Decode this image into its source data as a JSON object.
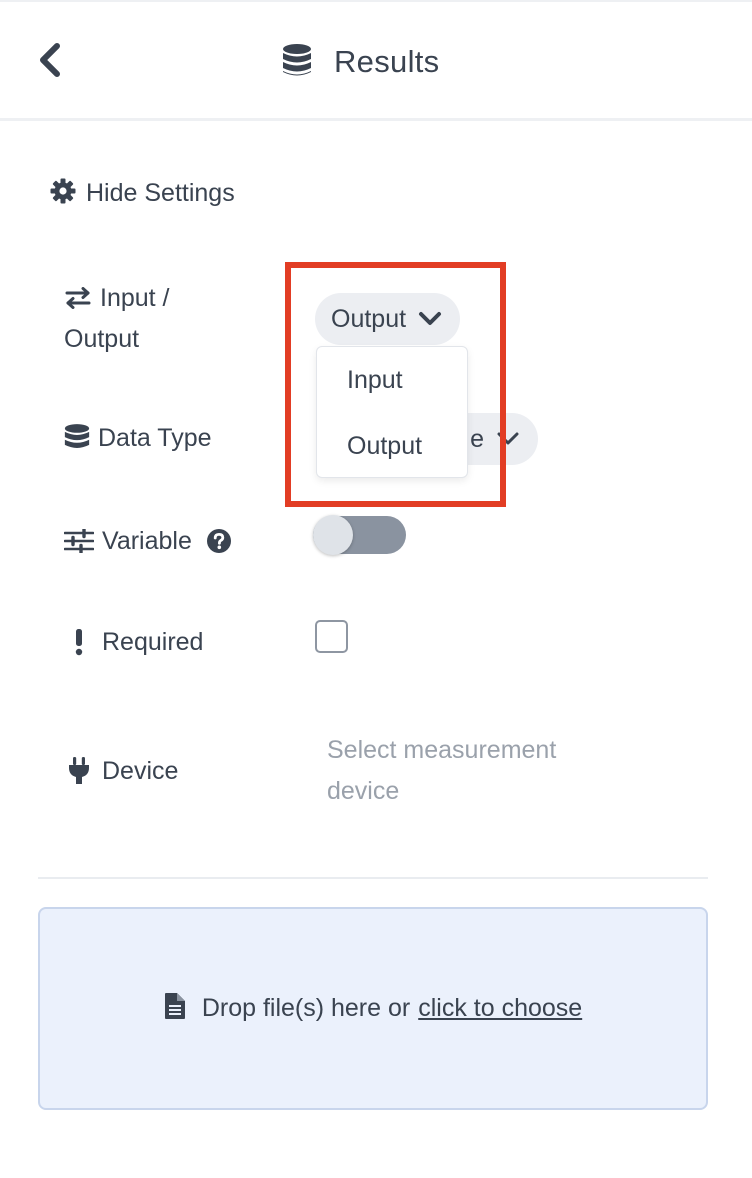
{
  "header": {
    "title": "Results",
    "back_icon": "chevron-left-icon",
    "title_icon": "database-icon"
  },
  "settings_toggle": {
    "label": "Hide Settings",
    "icon": "gear-icon"
  },
  "fields": {
    "input_output": {
      "label_line1": "Input /",
      "label_line2": "Output",
      "icon": "exchange-arrows-icon",
      "selected": "Output",
      "options": [
        "Input",
        "Output"
      ]
    },
    "data_type": {
      "label": "Data Type",
      "icon": "database-icon",
      "partial_value": "e"
    },
    "variable": {
      "label": "Variable",
      "icon": "sliders-icon",
      "help_icon": "question-circle-icon",
      "enabled": false
    },
    "required": {
      "label": "Required",
      "icon": "exclamation-icon",
      "checked": false
    },
    "device": {
      "label": "Device",
      "icon": "plug-icon",
      "placeholder_line1": "Select measurement",
      "placeholder_line2": "device"
    }
  },
  "dropzone": {
    "text": "Drop file(s) here or",
    "link": "click to choose",
    "icon": "file-icon"
  },
  "colors": {
    "text": "#3a4350",
    "highlight": "#e23d24",
    "dropzone_bg": "#ebf1fc",
    "toggle_off": "#8a93a0"
  }
}
